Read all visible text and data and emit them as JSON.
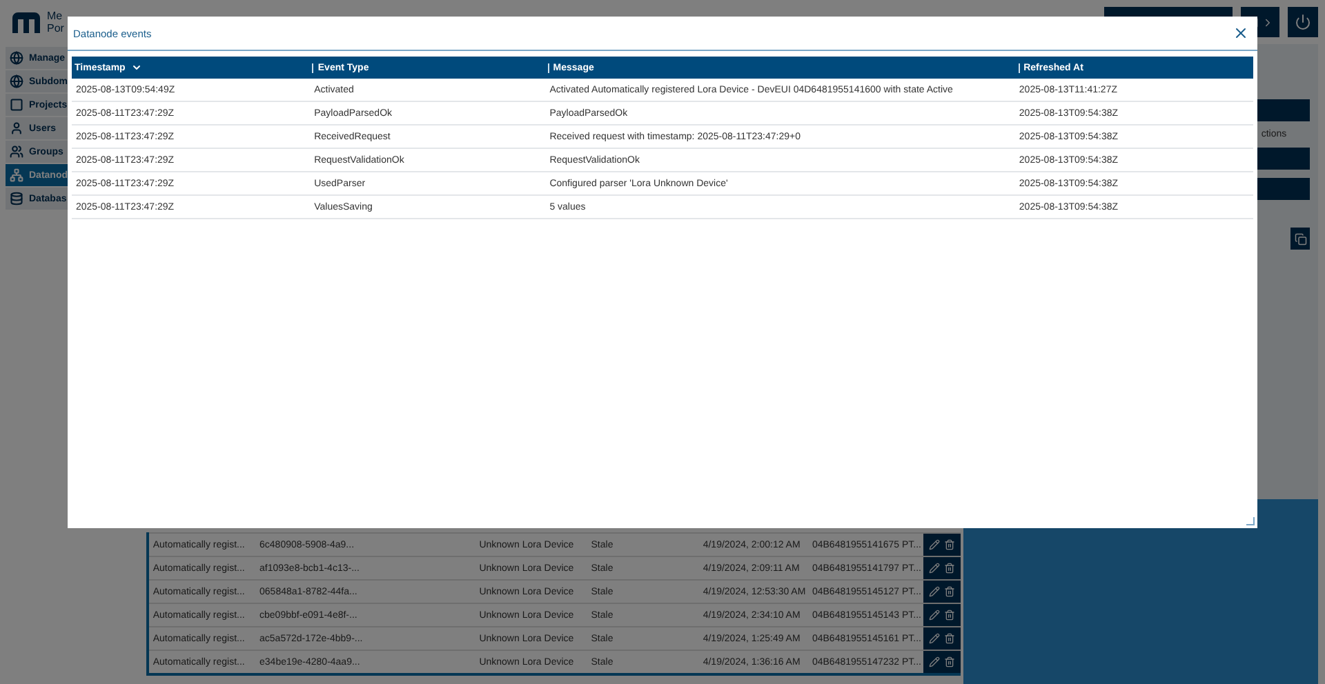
{
  "app": {
    "logo_lines": [
      "Me",
      "Por"
    ],
    "sidebar": [
      {
        "label": "Manage",
        "selected": false
      },
      {
        "label": "Subdom",
        "selected": false
      },
      {
        "label": "Projects",
        "selected": false
      },
      {
        "label": "Users",
        "selected": false
      },
      {
        "label": "Groups",
        "selected": false
      },
      {
        "label": "Datanod",
        "selected": true
      },
      {
        "label": "Databas",
        "selected": false
      }
    ],
    "right_panel": {
      "label": "ctions"
    },
    "table": {
      "rows": [
        {
          "cells": [
            "Automatically regist...",
            "6c480908-5908-4a9...",
            "Unknown Lora Device",
            "Stale",
            "4/19/2024, 2:00:12 AM",
            "04B6481955141675 PT..."
          ]
        },
        {
          "cells": [
            "Automatically regist...",
            "af1093e8-bcb1-4c13-...",
            "Unknown Lora Device",
            "Stale",
            "4/19/2024, 2:09:11 AM",
            "04B6481955141797 PT..."
          ]
        },
        {
          "cells": [
            "Automatically regist...",
            "065848a1-8782-44fa...",
            "Unknown Lora Device",
            "Stale",
            "4/19/2024, 12:53:30 AM",
            "04B6481955145127 PT..."
          ]
        },
        {
          "cells": [
            "Automatically regist...",
            "cbe09bbf-e091-4e8f-...",
            "Unknown Lora Device",
            "Stale",
            "4/19/2024, 2:34:10 AM",
            "04B6481955145143 PT..."
          ]
        },
        {
          "cells": [
            "Automatically regist...",
            "ac5a572d-172e-4bb9-...",
            "Unknown Lora Device",
            "Stale",
            "4/19/2024, 1:25:49 AM",
            "04B6481955145161 PT..."
          ]
        },
        {
          "cells": [
            "Automatically regist...",
            "e34be19e-4280-4aa9...",
            "Unknown Lora Device",
            "Stale",
            "4/19/2024, 1:36:16 AM",
            "04B6481955147232 PT..."
          ]
        }
      ]
    }
  },
  "dialog": {
    "title": "Datanode events",
    "columns": [
      {
        "label": "Timestamp",
        "sorted": true
      },
      {
        "label": "Event Type",
        "sorted": false
      },
      {
        "label": "Message",
        "sorted": false
      },
      {
        "label": "Refreshed At",
        "sorted": false
      }
    ],
    "rows": [
      {
        "cells": [
          "2025-08-13T09:54:49Z",
          "Activated",
          "Activated Automatically registered Lora Device - DevEUI 04D6481955141600 with state Active",
          "2025-08-13T11:41:27Z"
        ]
      },
      {
        "cells": [
          "2025-08-11T23:47:29Z",
          "PayloadParsedOk",
          "PayloadParsedOk",
          "2025-08-13T09:54:38Z"
        ]
      },
      {
        "cells": [
          "2025-08-11T23:47:29Z",
          "ReceivedRequest",
          "Received request with timestamp: 2025-08-11T23:47:29+0",
          "2025-08-13T09:54:38Z"
        ]
      },
      {
        "cells": [
          "2025-08-11T23:47:29Z",
          "RequestValidationOk",
          "RequestValidationOk",
          "2025-08-13T09:54:38Z"
        ]
      },
      {
        "cells": [
          "2025-08-11T23:47:29Z",
          "UsedParser",
          "Configured parser 'Lora Unknown Device'",
          "2025-08-13T09:54:38Z"
        ]
      },
      {
        "cells": [
          "2025-08-11T23:47:29Z",
          "ValuesSaving",
          "5 values",
          "2025-08-13T09:54:38Z"
        ]
      }
    ]
  }
}
